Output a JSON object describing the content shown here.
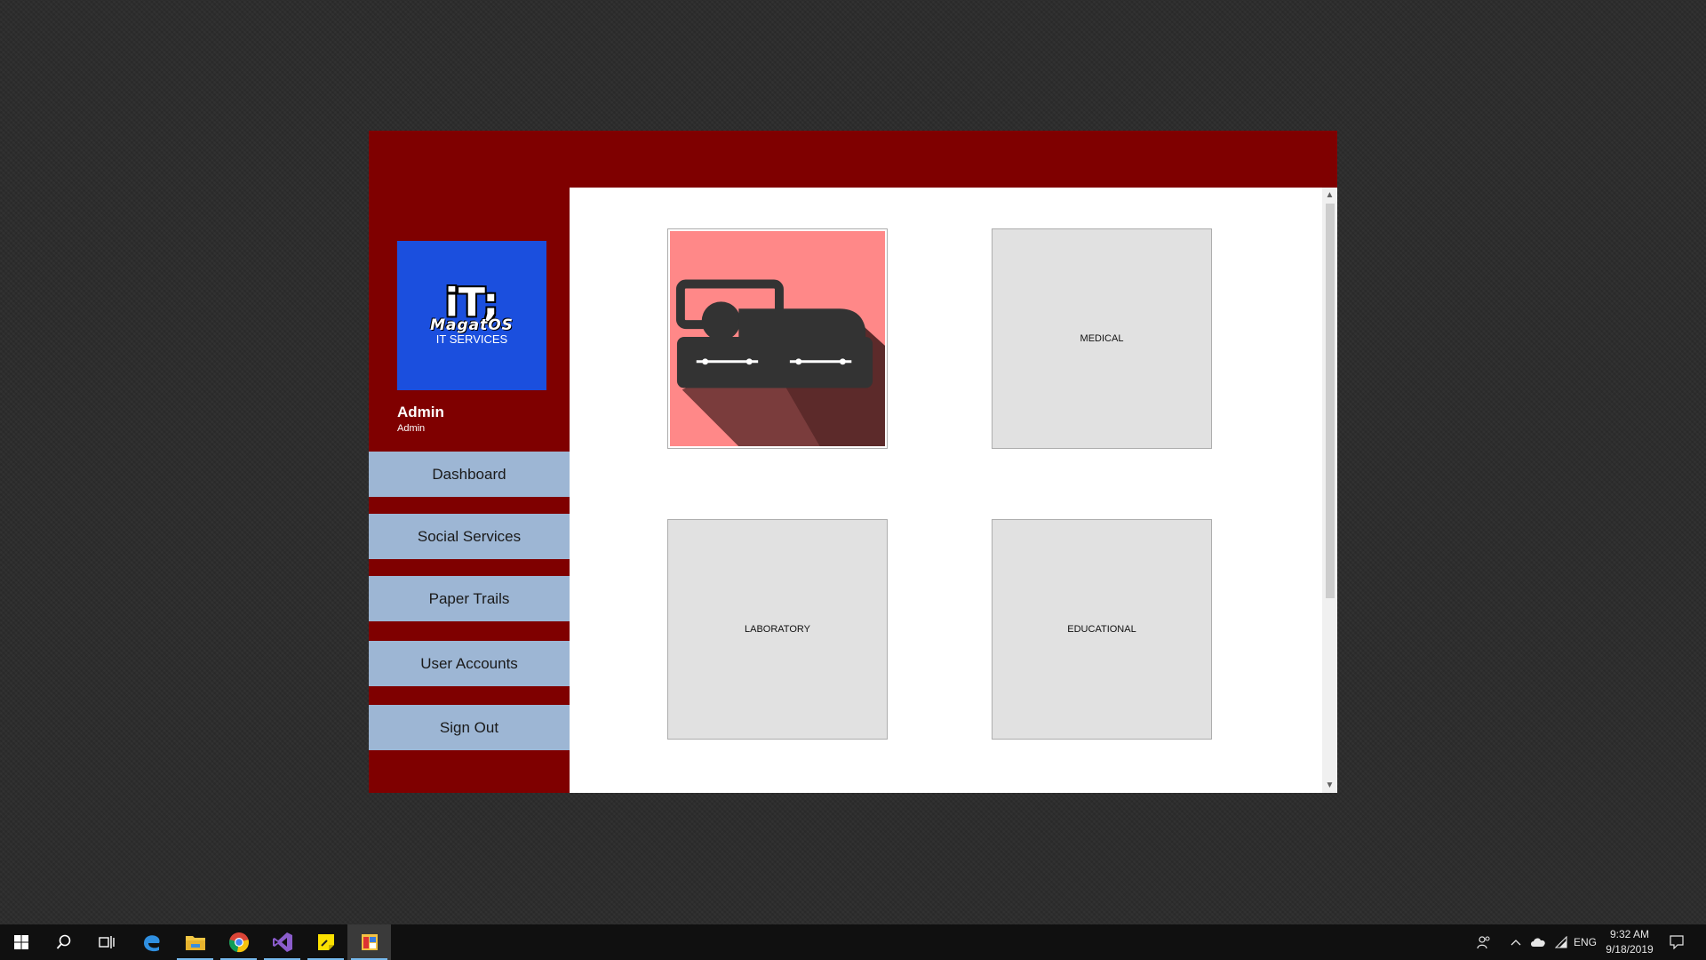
{
  "brand": {
    "logo_glyph": "iT;",
    "logo_name": "MagatOS",
    "logo_subtitle": "IT SERVICES",
    "logo_color": "#1b4fde"
  },
  "user": {
    "name": "Admin",
    "role": "Admin"
  },
  "sidebar": {
    "items": [
      {
        "label": "Dashboard"
      },
      {
        "label": "Social Services"
      },
      {
        "label": "Paper Trails"
      },
      {
        "label": "User Accounts"
      },
      {
        "label": "Sign Out"
      }
    ]
  },
  "tiles": [
    {
      "label": "",
      "icon": "bed-icon"
    },
    {
      "label": "MEDICAL"
    },
    {
      "label": "LABORATORY"
    },
    {
      "label": "EDUCATIONAL"
    }
  ],
  "taskbar": {
    "apps": [
      "edge-icon",
      "file-explorer-icon",
      "chrome-icon",
      "visual-studio-icon",
      "sticky-notes-icon",
      "app-window-icon"
    ],
    "language": "ENG",
    "time": "9:32 AM",
    "date": "9/18/2019"
  },
  "colors": {
    "window_background": "#7f0000",
    "nav_button": "#9db6d4",
    "tile_background": "#e1e1e1",
    "bed_tile_background": "#ff8888"
  }
}
